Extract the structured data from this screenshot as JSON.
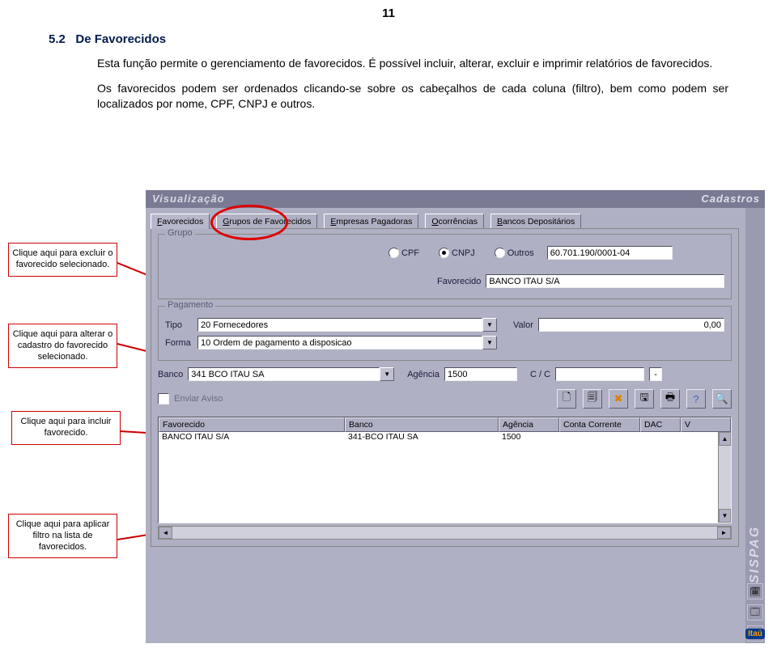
{
  "page_number": "11",
  "section": {
    "number": "5.2",
    "title": "De Favorecidos",
    "para1": "Esta função permite o gerenciamento de favorecidos. É possível incluir, alterar, excluir e imprimir relatórios de favorecidos.",
    "para2": "Os favorecidos podem ser ordenados clicando-se sobre os cabeçalhos de cada coluna (filtro), bem como podem ser localizados por nome, CPF, CNPJ e outros."
  },
  "callouts": {
    "c1": "Clique aqui para excluir o favorecido selecionado.",
    "c2": "Clique aqui para alterar o cadastro do favorecido selecionado.",
    "c3": "Clique aqui para incluir favorecido.",
    "c4": "Clique aqui para aplicar filtro na lista de favorecidos."
  },
  "app": {
    "title": "Visualização",
    "brand": "Cadastros",
    "vbrand": "SISPAG",
    "tabs": [
      "Favorecidos",
      "Grupos de Favorecidos",
      "Empresas Pagadoras",
      "Ocorrências",
      "Bancos Depositários"
    ],
    "grupo": {
      "legend": "Grupo",
      "cpf": "CPF",
      "cnpj": "CNPJ",
      "outros": "Outros",
      "id_value": "60.701.190/0001-04",
      "fav_label": "Favorecido",
      "fav_value": "BANCO ITAU S/A"
    },
    "pagamento": {
      "legend": "Pagamento",
      "tipo_label": "Tipo",
      "tipo_value": "20 Fornecedores",
      "valor_label": "Valor",
      "valor_value": "0,00",
      "forma_label": "Forma",
      "forma_value": "10 Ordem de pagamento a disposicao"
    },
    "banco": {
      "banco_label": "Banco",
      "banco_value": "341 BCO ITAU SA",
      "agencia_label": "Agência",
      "agencia_value": "1500",
      "cc_label": "C / C",
      "cc_value": "",
      "cc_dv": "-"
    },
    "enviar_aviso": "Enviar Aviso",
    "table": {
      "headers": [
        "Favorecido",
        "Banco",
        "Agência",
        "Conta Corrente",
        "DAC",
        "V"
      ],
      "row": [
        "BANCO ITAU S/A",
        "341-BCO ITAU SA",
        "1500",
        "",
        "",
        ""
      ]
    },
    "footer_logo": "Itaú"
  }
}
